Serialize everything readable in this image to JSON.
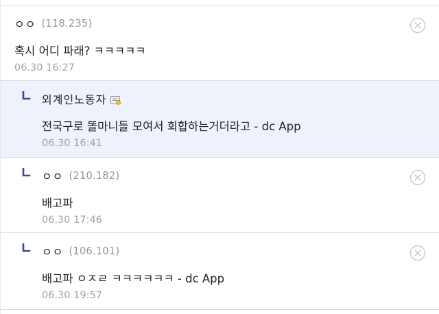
{
  "comments": [
    {
      "nick": "ㅇㅇ",
      "ip": "(118.235)",
      "text": "혹시 어디 파래? ㅋㅋㅋㅋㅋ",
      "date": "06.30 16:27",
      "is_reply": false,
      "deletable": true
    },
    {
      "nick": "외계인노동자",
      "ip": "",
      "text": "전국구로 똘마니들 모여서 회합하는거더라고 - dc App",
      "date": "06.30 16:41",
      "is_reply": true,
      "has_gallcon_icon": true,
      "deletable": false
    },
    {
      "nick": "ㅇㅇ",
      "ip": "(210.182)",
      "text": "배고파",
      "date": "06.30 17:46",
      "is_reply": true,
      "deletable": true
    },
    {
      "nick": "ㅇㅇ",
      "ip": "(106.101)",
      "text": "배고파 ㅇㅈㄹ ㅋㅋㅋㅋㅋㅋ - dc App",
      "date": "06.30 19:57",
      "is_reply": true,
      "deletable": true
    }
  ],
  "icons": {
    "reply_marker": "reply-arrow-icon",
    "delete": "delete-circle-x-icon",
    "gallcon": "gallery-user-badge-icon"
  },
  "colors": {
    "highlight_background": "#eef2fa",
    "reply_marker": "#3b4890",
    "meta_gray": "#a3a3a3",
    "divider": "#dcdcdc"
  }
}
